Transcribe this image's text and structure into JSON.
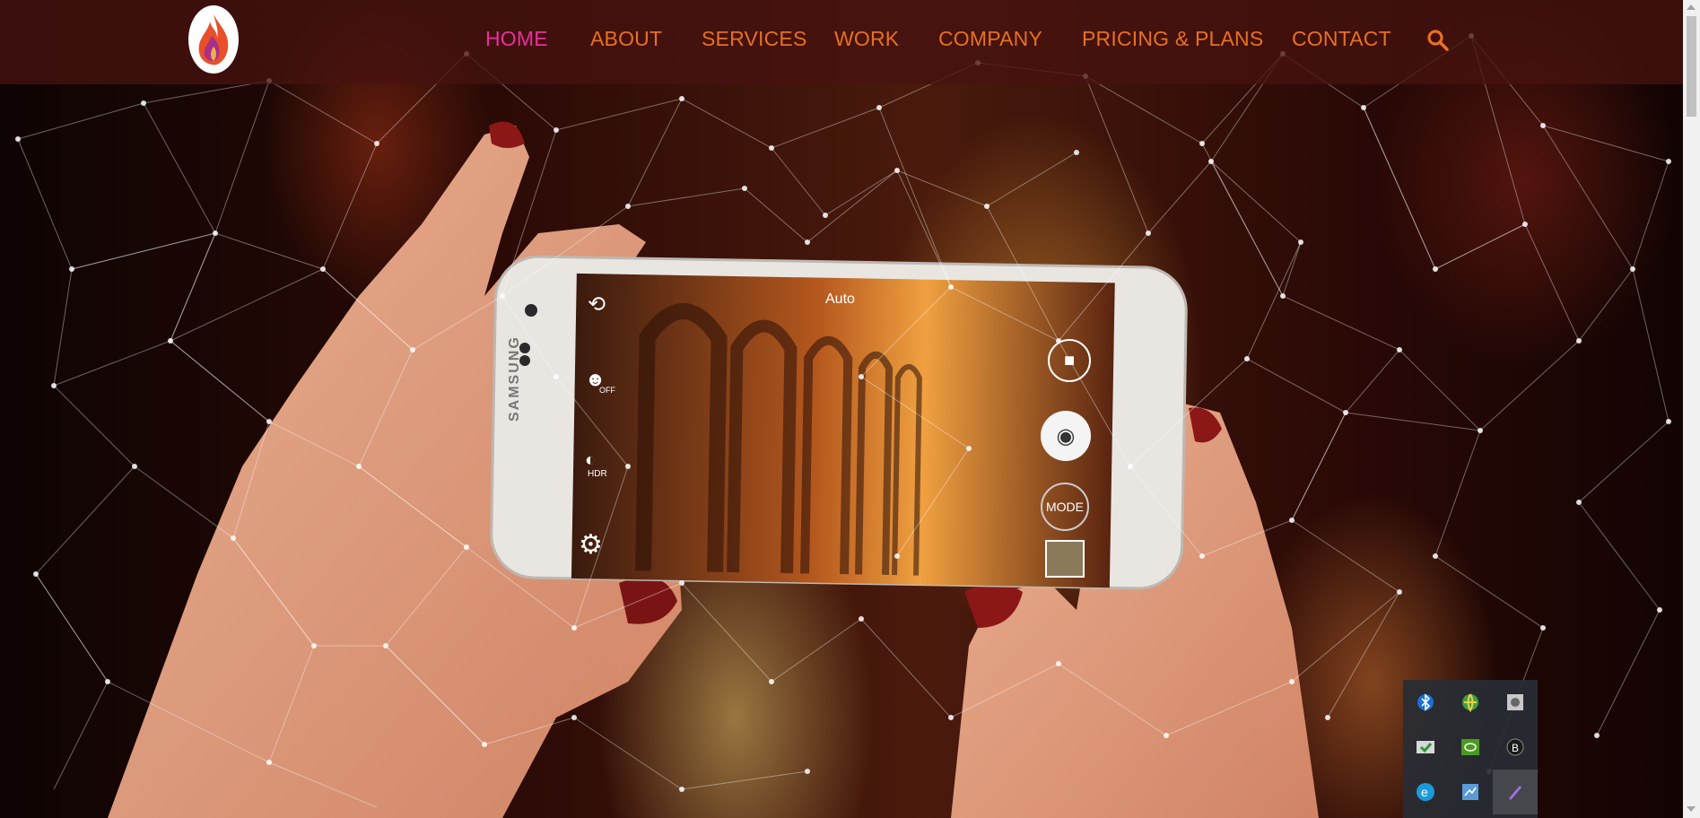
{
  "nav": {
    "items": [
      {
        "label": "HOME",
        "active": true
      },
      {
        "label": "ABOUT",
        "active": false
      },
      {
        "label": "SERVICES",
        "active": false
      },
      {
        "label": "WORK",
        "active": false
      },
      {
        "label": "COMPANY",
        "active": false
      },
      {
        "label": "PRICING & PLANS",
        "active": false
      },
      {
        "label": "CONTACT",
        "active": false
      }
    ],
    "search_icon": "search-icon",
    "colors": {
      "link": "#e8701f",
      "active": "#e8309a",
      "bar": "#461210"
    }
  },
  "logo": {
    "icon": "flame-logo-icon"
  },
  "hero": {
    "phone": {
      "brand": "SAMSUNG",
      "camera_mode_label": "Auto",
      "hdr_label": "HDR",
      "face_label": "OFF",
      "mode_button_label": "MODE"
    }
  },
  "tray": {
    "icons": [
      "bluetooth-icon",
      "network-globe-icon",
      "disk-icon",
      "security-check-icon",
      "nvidia-icon",
      "app-b-icon",
      "edge-icon",
      "display-icon",
      "pen-icon"
    ]
  }
}
